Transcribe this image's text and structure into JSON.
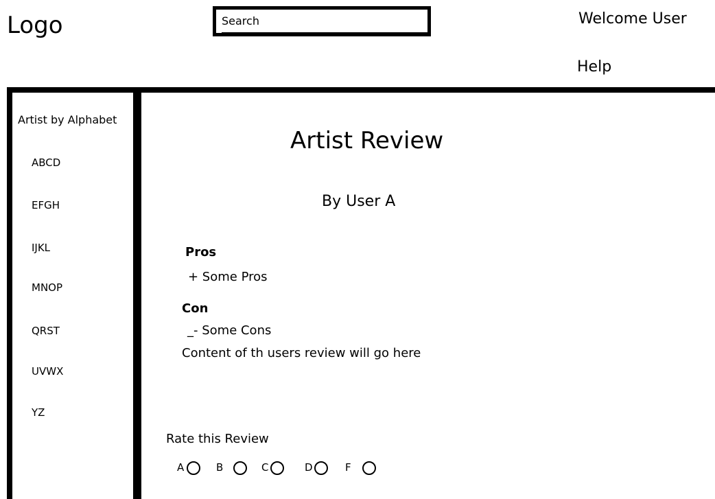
{
  "header": {
    "logo": "Logo",
    "search_placeholder": "Search",
    "welcome": "Welcome User",
    "help": "Help"
  },
  "sidebar": {
    "title": "Artist by Alphabet",
    "items": [
      "ABCD",
      "EFGH",
      "IJKL",
      "MNOP",
      "QRST",
      "UVWX",
      "YZ"
    ]
  },
  "review": {
    "title": "Artist Review",
    "author": "By User A",
    "pros_heading": "Pros",
    "pros_item": "+ Some Pros",
    "cons_heading": "Con",
    "cons_item": "_- Some Cons",
    "body": "Content of th users review will go here"
  },
  "rating": {
    "label": "Rate this Review",
    "options": [
      "A",
      "B",
      "C",
      "D",
      "F"
    ]
  }
}
